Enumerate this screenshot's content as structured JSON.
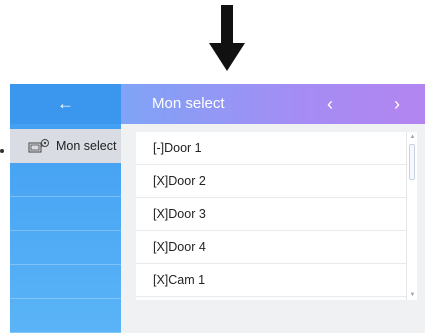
{
  "indicator": {
    "icon": "down-arrow-icon"
  },
  "sidebar": {
    "back_icon": "←",
    "active_item": {
      "label": "Mon select",
      "icon": "monitor-select-icon"
    }
  },
  "header": {
    "title": "Mon select",
    "prev_label": "‹",
    "next_label": "›"
  },
  "list": {
    "items": [
      {
        "label": "[-]Door 1"
      },
      {
        "label": "[X]Door 2"
      },
      {
        "label": "[X]Door 3"
      },
      {
        "label": "[X]Door 4"
      },
      {
        "label": "[X]Cam 1"
      }
    ]
  },
  "colors": {
    "sidebar_blue": "#3f9df0",
    "header_gradient_start": "#7fa4f6",
    "header_gradient_end": "#b385f0",
    "background": "#f0f1f3"
  }
}
